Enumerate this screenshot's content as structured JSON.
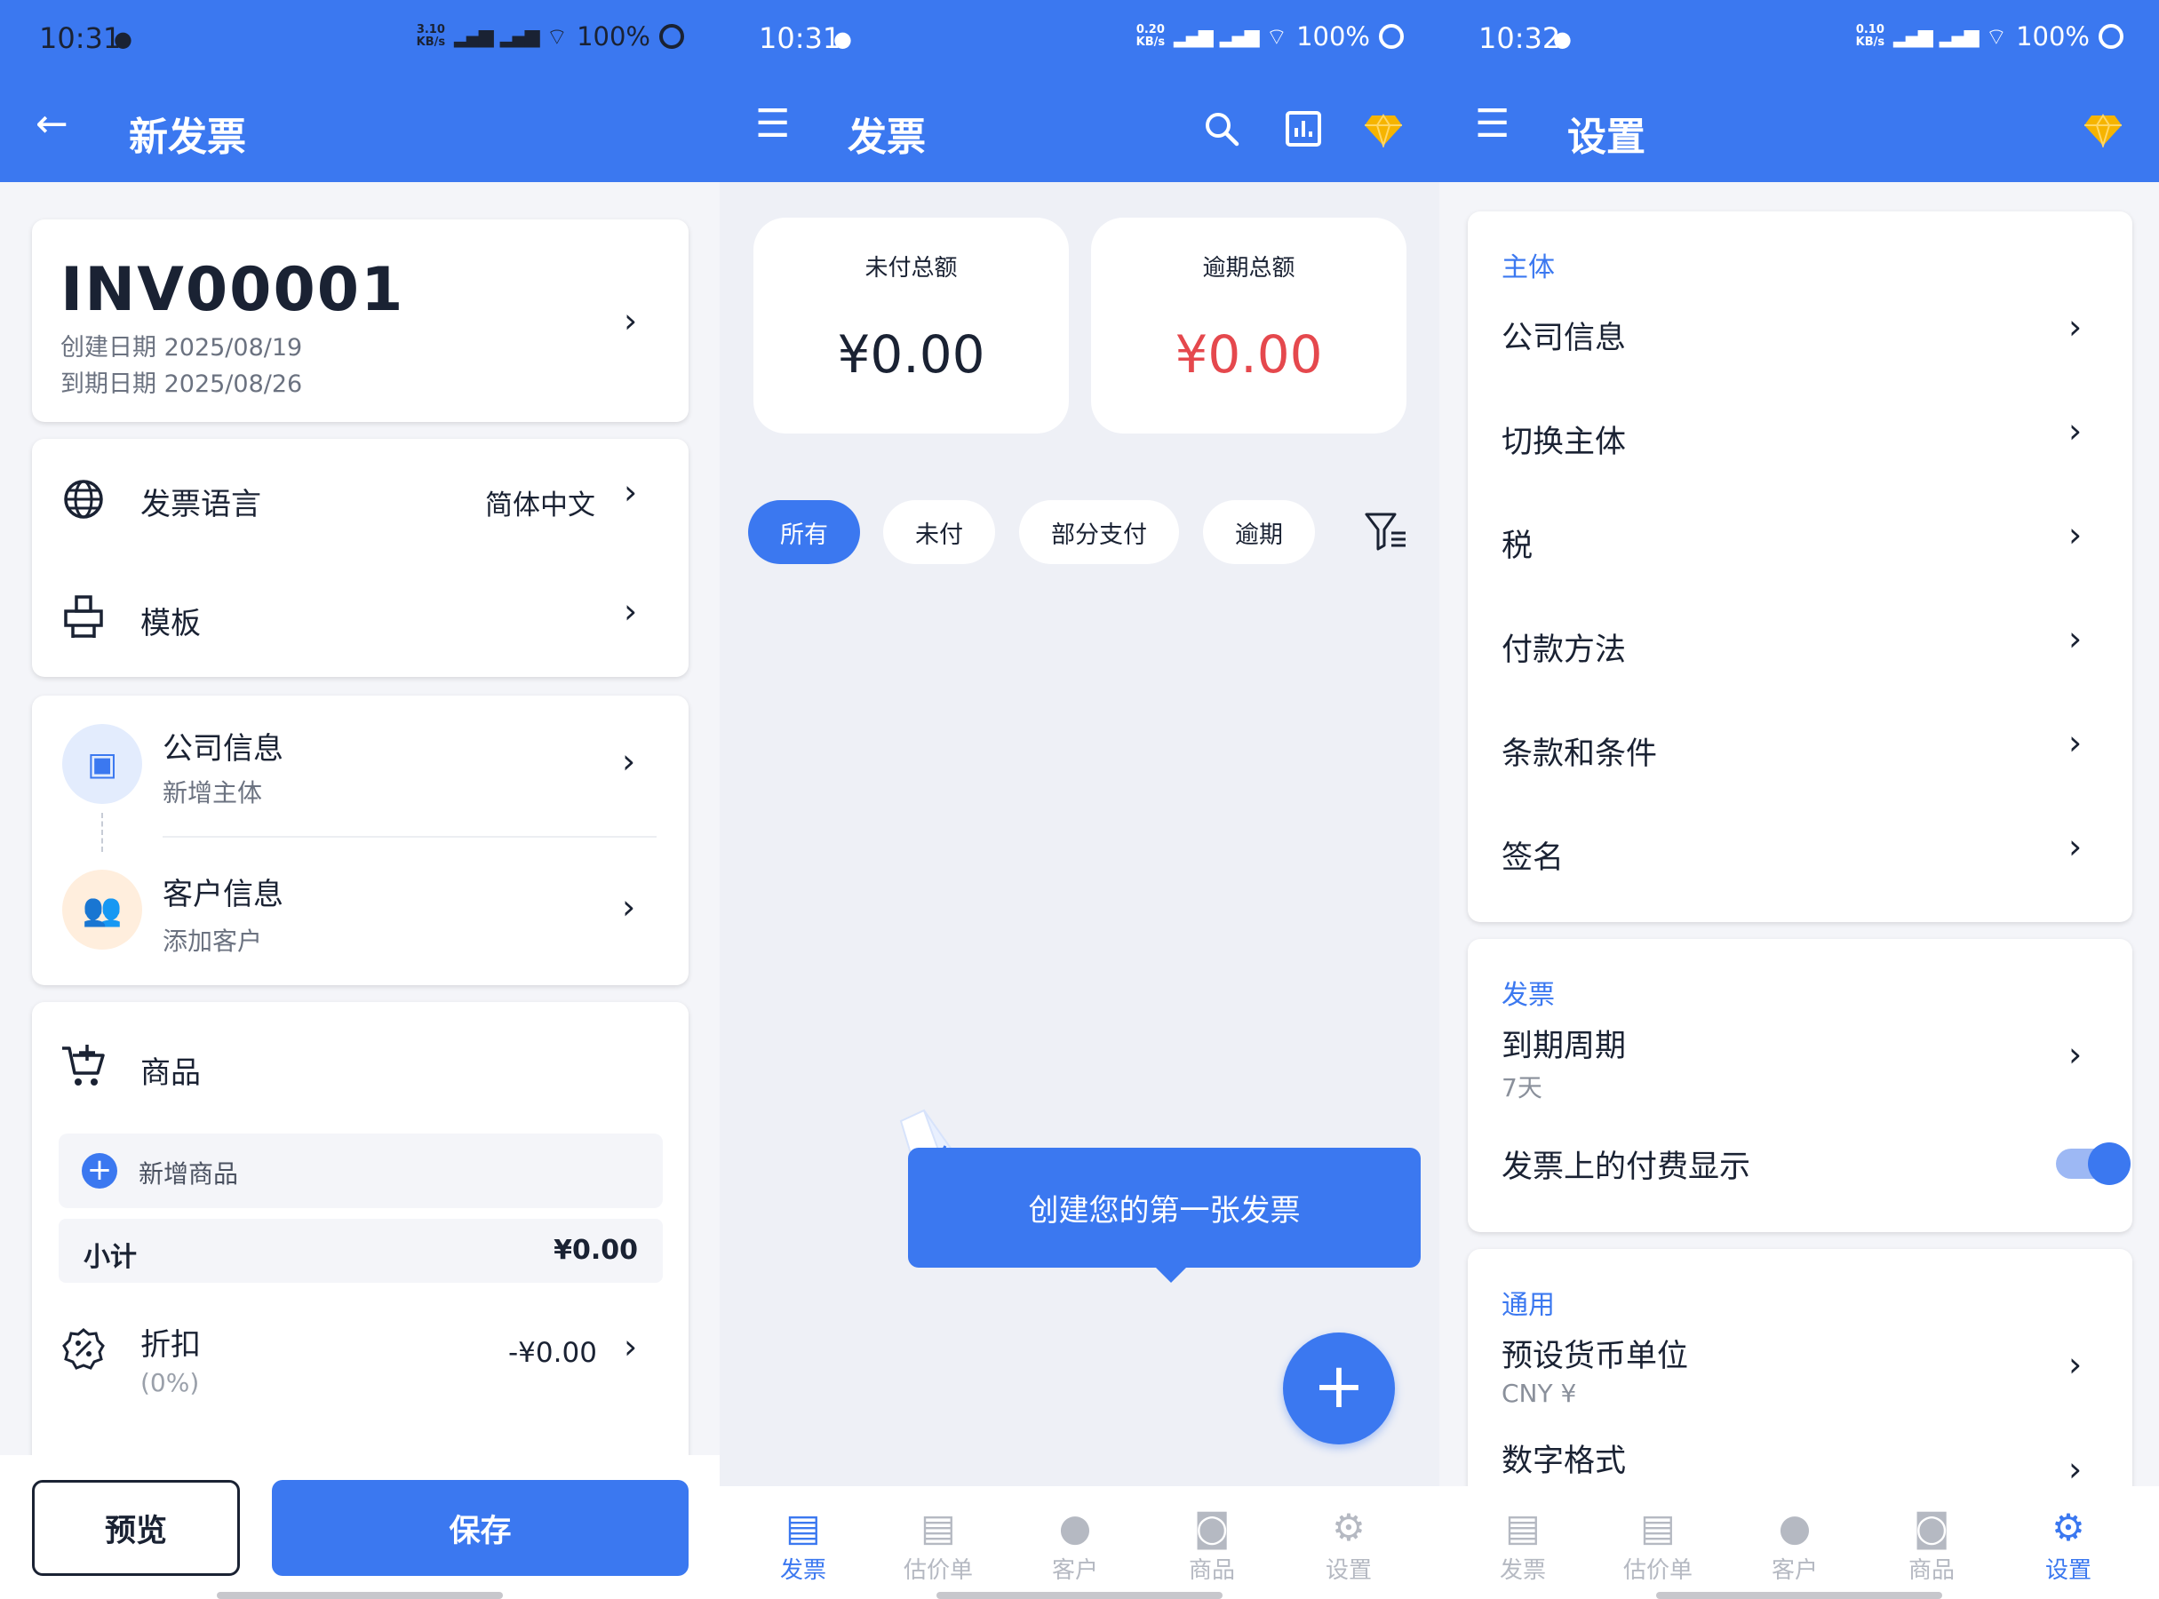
{
  "screen1": {
    "status": {
      "time": "10:31",
      "speed": "3.10",
      "speed_unit": "KB/s",
      "battery": "100%"
    },
    "title": "新发票",
    "invoice": {
      "number": "INV00001",
      "created": "创建日期 2025/08/19",
      "due": "到期日期 2025/08/26"
    },
    "language_label": "发票语言",
    "language_value": "简体中文",
    "template_label": "模板",
    "company": {
      "title": "公司信息",
      "subtitle": "新增主体"
    },
    "client": {
      "title": "客户信息",
      "subtitle": "添加客户"
    },
    "items_label": "商品",
    "add_item": "新增商品",
    "subtotal_label": "小计",
    "subtotal_value": "¥0.00",
    "discount_label": "折扣",
    "discount_pct": "(0%)",
    "discount_value": "-¥0.00",
    "preview_button": "预览",
    "save_button": "保存"
  },
  "screen2": {
    "status": {
      "time": "10:31",
      "speed": "0.20",
      "speed_unit": "KB/s",
      "battery": "100%"
    },
    "title": "发票",
    "unpaid_label": "未付总额",
    "unpaid_value": "¥0.00",
    "overdue_label": "逾期总额",
    "overdue_value": "¥0.00",
    "chips": [
      "所有",
      "未付",
      "部分支付",
      "逾期"
    ],
    "tooltip": "创建您的第一张发票",
    "nav": [
      "发票",
      "估价单",
      "客户",
      "商品",
      "设置"
    ]
  },
  "screen3": {
    "status": {
      "time": "10:32",
      "speed": "0.10",
      "speed_unit": "KB/s",
      "battery": "100%"
    },
    "title": "设置",
    "section_entity": "主体",
    "entity_items": [
      "公司信息",
      "切换主体",
      "税",
      "付款方法",
      "条款和条件",
      "签名"
    ],
    "section_invoice": "发票",
    "due_period_label": "到期周期",
    "due_period_value": "7天",
    "payment_display_label": "发票上的付费显示",
    "payment_display_on": true,
    "section_general": "通用",
    "currency_label": "预设货币单位",
    "currency_value": "CNY ¥",
    "number_format_label": "数字格式",
    "nav": [
      "发票",
      "估价单",
      "客户",
      "商品",
      "设置"
    ]
  },
  "colors": {
    "primary": "#3b78f0",
    "overdue_red": "#e5484d",
    "premium_gold": "#f6b400"
  },
  "icons": {
    "back": "arrow-left-icon",
    "menu": "menu-icon",
    "search": "search-icon",
    "chart": "chart-icon",
    "premium": "diamond-icon"
  }
}
